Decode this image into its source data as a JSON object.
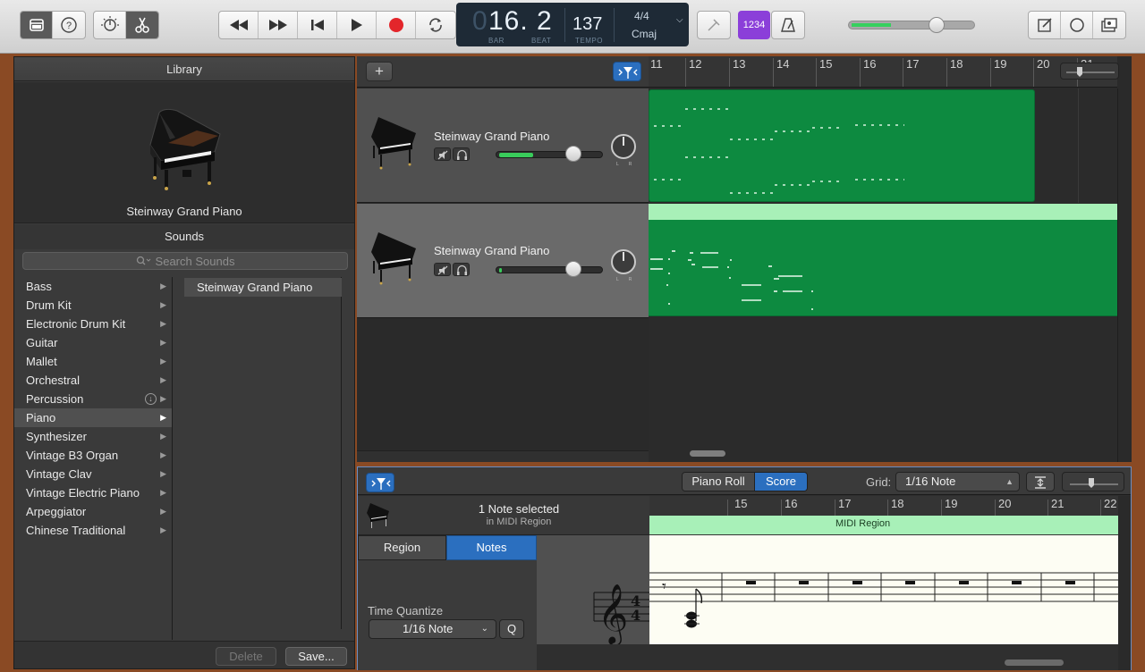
{
  "toolbar": {
    "lcd": {
      "position": "16. 2",
      "position_dim": "0",
      "bar_label": "BAR",
      "beat_label": "BEAT",
      "tempo": "137",
      "tempo_label": "TEMPO",
      "time_signature": "4/4",
      "key": "Cmaj"
    },
    "count_in": "1234",
    "master_volume": 0.62,
    "accent": "#8b3fd9"
  },
  "library": {
    "title": "Library",
    "selected_instrument": "Steinway Grand Piano",
    "sounds_title": "Sounds",
    "search_placeholder": "Search Sounds",
    "categories": [
      {
        "label": "Bass"
      },
      {
        "label": "Drum Kit"
      },
      {
        "label": "Electronic Drum Kit"
      },
      {
        "label": "Guitar"
      },
      {
        "label": "Mallet"
      },
      {
        "label": "Orchestral"
      },
      {
        "label": "Percussion"
      },
      {
        "label": "Piano"
      },
      {
        "label": "Synthesizer"
      },
      {
        "label": "Vintage B3 Organ"
      },
      {
        "label": "Vintage Clav"
      },
      {
        "label": "Vintage Electric Piano"
      },
      {
        "label": "Arpeggiator"
      },
      {
        "label": "Chinese Traditional"
      }
    ],
    "selected_category": "Piano",
    "patches": [
      "Steinway Grand Piano"
    ],
    "delete_label": "Delete",
    "save_label": "Save..."
  },
  "tracks": {
    "ruler_bars": [
      "11",
      "12",
      "13",
      "14",
      "15",
      "16",
      "17",
      "18",
      "19",
      "20",
      "21"
    ],
    "items": [
      {
        "name": "Steinway Grand Piano",
        "volume_level": 0.35
      },
      {
        "name": "Steinway Grand Piano",
        "volume_level": 0.02
      }
    ]
  },
  "editor": {
    "view_piano_roll": "Piano Roll",
    "view_score": "Score",
    "grid_label": "Grid:",
    "grid_value": "1/16 Note",
    "selection_text": "1 Note selected",
    "selection_sub": "in MIDI Region",
    "tab_region": "Region",
    "tab_notes": "Notes",
    "time_quantize_label": "Time Quantize",
    "time_quantize_value": "1/16 Note",
    "q_label": "Q",
    "ruler_bars": [
      "15",
      "16",
      "17",
      "18",
      "19",
      "20",
      "21",
      "22"
    ],
    "region_label": "MIDI Region"
  }
}
